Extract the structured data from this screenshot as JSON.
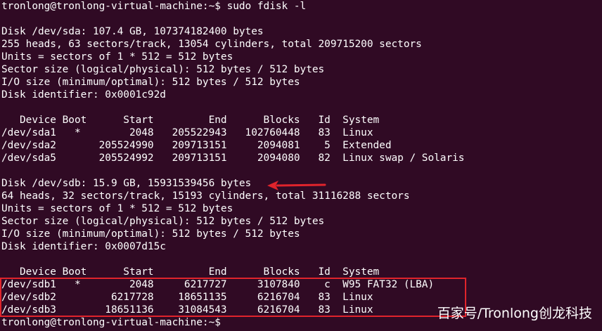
{
  "terminal": {
    "lines": [
      "tronlong@tronlong-virtual-machine:~$ sudo fdisk -l",
      "",
      "Disk /dev/sda: 107.4 GB, 107374182400 bytes",
      "255 heads, 63 sectors/track, 13054 cylinders, total 209715200 sectors",
      "Units = sectors of 1 * 512 = 512 bytes",
      "Sector size (logical/physical): 512 bytes / 512 bytes",
      "I/O size (minimum/optimal): 512 bytes / 512 bytes",
      "Disk identifier: 0x0001c92d",
      "",
      "   Device Boot      Start         End      Blocks   Id  System",
      "/dev/sda1   *        2048   205522943   102760448   83  Linux",
      "/dev/sda2       205524990   209713151     2094081    5  Extended",
      "/dev/sda5       205524992   209713151     2094080   82  Linux swap / Solaris",
      "",
      "Disk /dev/sdb: 15.9 GB, 15931539456 bytes",
      "64 heads, 32 sectors/track, 15193 cylinders, total 31116288 sectors",
      "Units = sectors of 1 * 512 = 512 bytes",
      "Sector size (logical/physical): 512 bytes / 512 bytes",
      "I/O size (minimum/optimal): 512 bytes / 512 bytes",
      "Disk identifier: 0x0007d15c",
      "",
      "   Device Boot      Start         End      Blocks   Id  System",
      "/dev/sdb1   *        2048     6217727     3107840    c  W95 FAT32 (LBA)",
      "/dev/sdb2         6217728    18651135     6216704   83  Linux",
      "/dev/sdb3        18651136    31084543     6216704   83  Linux",
      "tronlong@tronlong-virtual-machine:~$ "
    ]
  },
  "watermark": "百家号/Tronlong创龙科技",
  "colors": {
    "background": "#300a24",
    "text": "#ffffff",
    "annotation": "#e0242c"
  }
}
